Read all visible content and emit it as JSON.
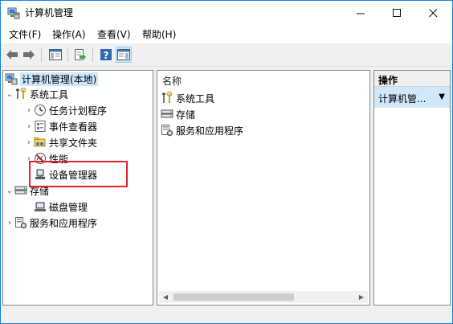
{
  "window": {
    "title": "计算机管理",
    "app_icon": "computer-management-icon",
    "controls": {
      "minimize": "—",
      "maximize": "☐",
      "close": "✕"
    }
  },
  "menubar": {
    "items": [
      {
        "label": "文件(F)"
      },
      {
        "label": "操作(A)"
      },
      {
        "label": "查看(V)"
      },
      {
        "label": "帮助(H)"
      }
    ]
  },
  "toolbar": {
    "buttons": [
      {
        "icon": "back-arrow-icon"
      },
      {
        "icon": "forward-arrow-icon"
      },
      {
        "icon": "show-hide-tree-icon"
      },
      {
        "icon": "export-list-icon"
      },
      {
        "icon": "help-icon"
      },
      {
        "icon": "show-hide-action-pane-icon"
      }
    ]
  },
  "tree": {
    "root": {
      "label": "计算机管理(本地)",
      "icon": "computer-management-icon"
    },
    "system_tools": {
      "label": "系统工具",
      "icon": "system-tools-icon",
      "expanded": true
    },
    "system_children": [
      {
        "label": "任务计划程序",
        "icon": "task-scheduler-icon"
      },
      {
        "label": "事件查看器",
        "icon": "event-viewer-icon"
      },
      {
        "label": "共享文件夹",
        "icon": "shared-folders-icon"
      },
      {
        "label": "性能",
        "icon": "performance-icon"
      },
      {
        "label": "设备管理器",
        "icon": "device-manager-icon"
      }
    ],
    "storage": {
      "label": "存储",
      "icon": "storage-icon",
      "expanded": true
    },
    "storage_children": [
      {
        "label": "磁盘管理",
        "icon": "disk-management-icon"
      }
    ],
    "services": {
      "label": "服务和应用程序",
      "icon": "services-applications-icon"
    }
  },
  "content": {
    "column_header": "名称",
    "items": [
      {
        "label": "系统工具",
        "icon": "system-tools-icon"
      },
      {
        "label": "存储",
        "icon": "storage-icon"
      },
      {
        "label": "服务和应用程序",
        "icon": "services-applications-icon"
      }
    ]
  },
  "actions": {
    "header": "操作",
    "item": "计算机管...",
    "caret": "▼"
  },
  "colors": {
    "window_border": "#1883d7",
    "highlight": "#e0222d",
    "action_selected": "#d1e8fb"
  }
}
